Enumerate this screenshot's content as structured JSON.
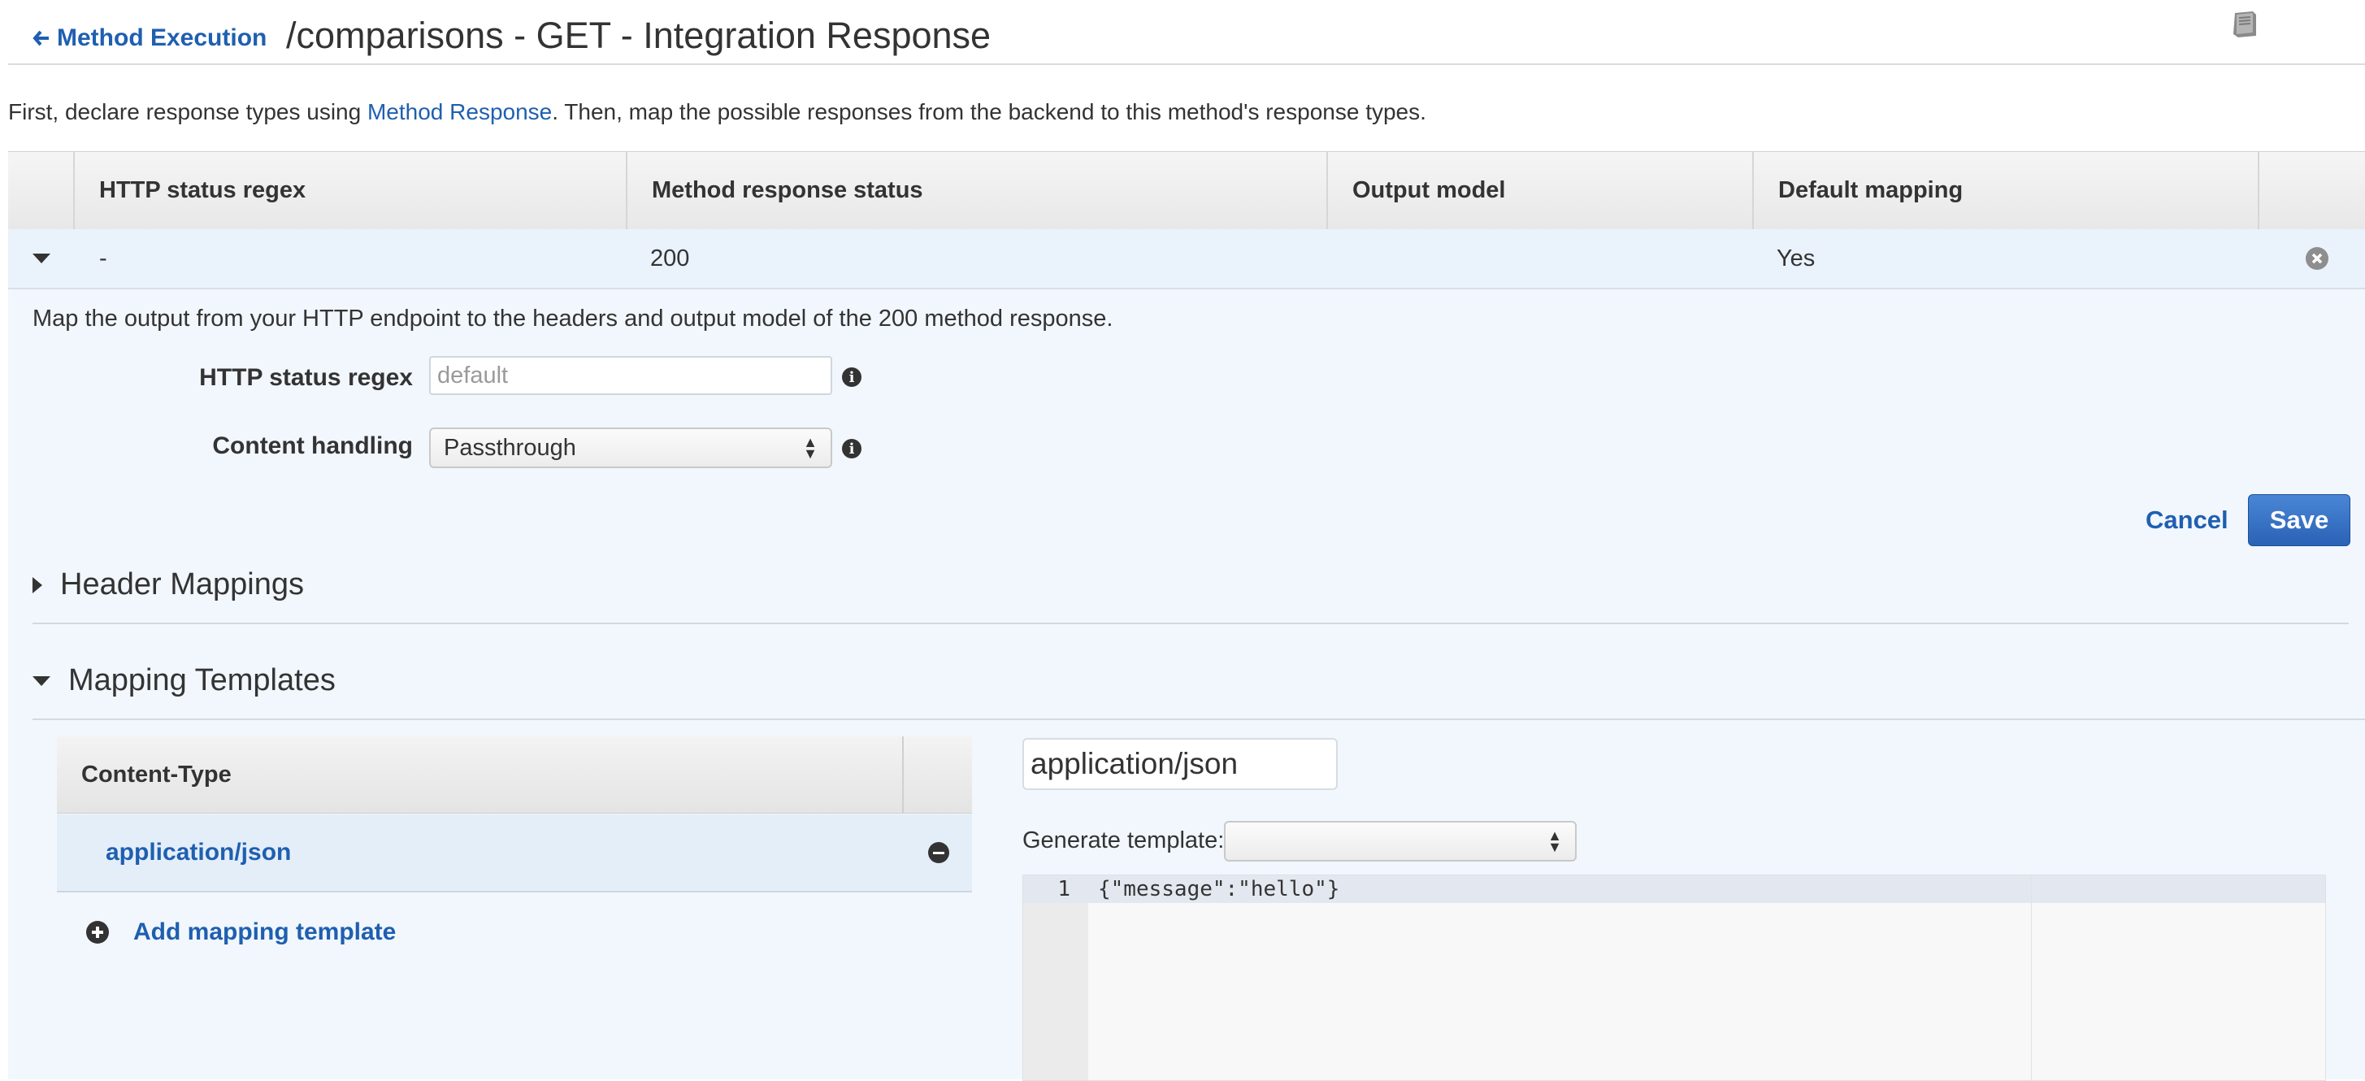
{
  "header": {
    "back_label": "Method Execution",
    "title": "/comparisons - GET - Integration Response"
  },
  "intro": {
    "before": "First, declare response types using ",
    "link": "Method Response",
    "after": ". Then, map the possible responses from the backend to this method's response types."
  },
  "responses_table": {
    "columns": [
      "HTTP status regex",
      "Method response status",
      "Output model",
      "Default mapping"
    ],
    "rows": [
      {
        "regex": "-",
        "status": "200",
        "model": "",
        "default": "Yes"
      }
    ]
  },
  "detail": {
    "description": "Map the output from your HTTP endpoint to the headers and output model of the 200 method response.",
    "regex_label": "HTTP status regex",
    "regex_placeholder": "default",
    "content_handling_label": "Content handling",
    "content_handling_value": "Passthrough",
    "cancel_label": "Cancel",
    "save_label": "Save"
  },
  "sections": {
    "header_mappings": "Header Mappings",
    "mapping_templates": "Mapping Templates"
  },
  "templates": {
    "column": "Content-Type",
    "items": [
      "application/json"
    ],
    "add_label": "Add mapping template",
    "selected_type": "application/json",
    "generate_label": "Generate template:",
    "generate_value": ""
  },
  "editor": {
    "line_number": "1",
    "code": "{\"message\":\"hello\"}"
  }
}
